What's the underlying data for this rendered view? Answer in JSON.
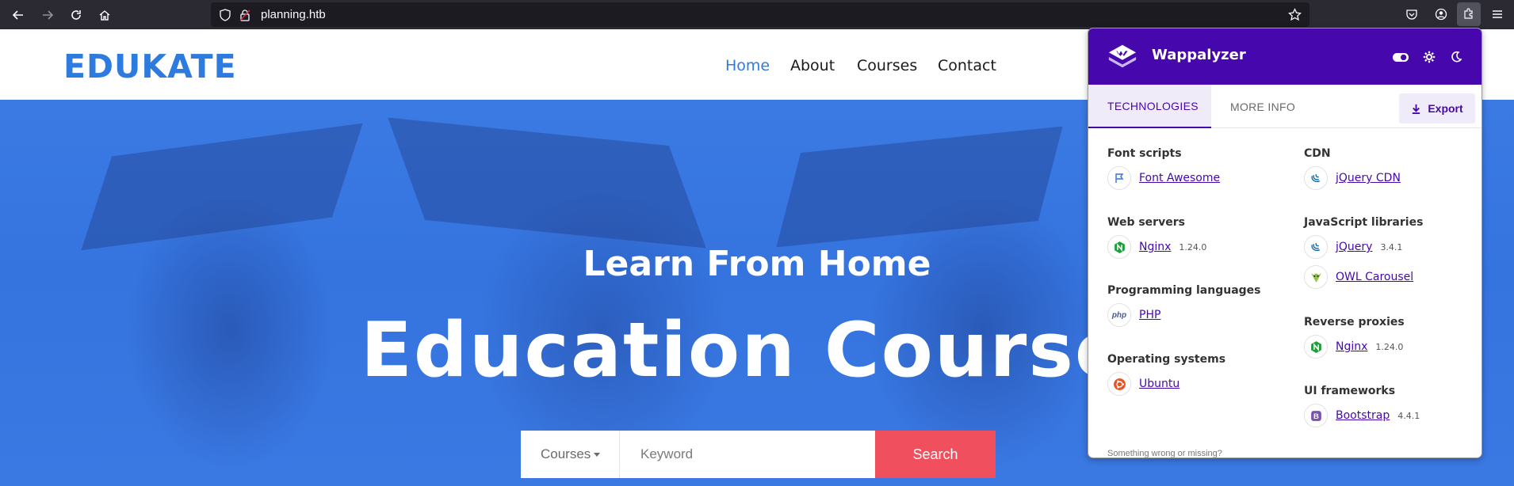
{
  "browser": {
    "url": "planning.htb",
    "icons": [
      "back-icon",
      "forward-icon",
      "reload-icon",
      "home-icon",
      "shield-icon",
      "lock-icon",
      "star-icon",
      "pocket-icon",
      "account-icon",
      "extensions-icon",
      "menu-icon"
    ]
  },
  "site": {
    "logo": "EDUKATE",
    "nav": [
      "Home",
      "About",
      "Courses",
      "Contact"
    ],
    "active_nav": "Home",
    "brand_color": "#2e7be0"
  },
  "hero": {
    "subtitle": "Learn From Home",
    "title": "Education Course",
    "select_label": "Courses",
    "keyword_placeholder": "Keyword",
    "search_label": "Search",
    "search_color": "#f0505d"
  },
  "wappalyzer": {
    "brand": "Wappalyzer",
    "accent": "#4608ad",
    "tabs": [
      "TECHNOLOGIES",
      "MORE INFO"
    ],
    "export_label": "Export",
    "left_column": [
      {
        "category": "Font scripts",
        "items": [
          {
            "name": "Font Awesome",
            "version": "",
            "icon": "flag-icon"
          }
        ]
      },
      {
        "category": "Web servers",
        "items": [
          {
            "name": "Nginx",
            "version": "1.24.0",
            "icon": "nginx-icon"
          }
        ]
      },
      {
        "category": "Programming languages",
        "items": [
          {
            "name": "PHP",
            "version": "",
            "icon": "php-icon"
          }
        ]
      },
      {
        "category": "Operating systems",
        "items": [
          {
            "name": "Ubuntu",
            "version": "",
            "icon": "ubuntu-icon"
          }
        ]
      }
    ],
    "right_column": [
      {
        "category": "CDN",
        "items": [
          {
            "name": "jQuery CDN",
            "version": "",
            "icon": "jquery-icon"
          }
        ]
      },
      {
        "category": "JavaScript libraries",
        "items": [
          {
            "name": "jQuery",
            "version": "3.4.1",
            "icon": "jquery-icon"
          },
          {
            "name": "OWL Carousel",
            "version": "",
            "icon": "owl-icon"
          }
        ]
      },
      {
        "category": "Reverse proxies",
        "items": [
          {
            "name": "Nginx",
            "version": "1.24.0",
            "icon": "nginx-icon"
          }
        ]
      },
      {
        "category": "UI frameworks",
        "items": [
          {
            "name": "Bootstrap",
            "version": "4.4.1",
            "icon": "bootstrap-icon"
          }
        ]
      }
    ],
    "footer": "Something wrong or missing?"
  }
}
